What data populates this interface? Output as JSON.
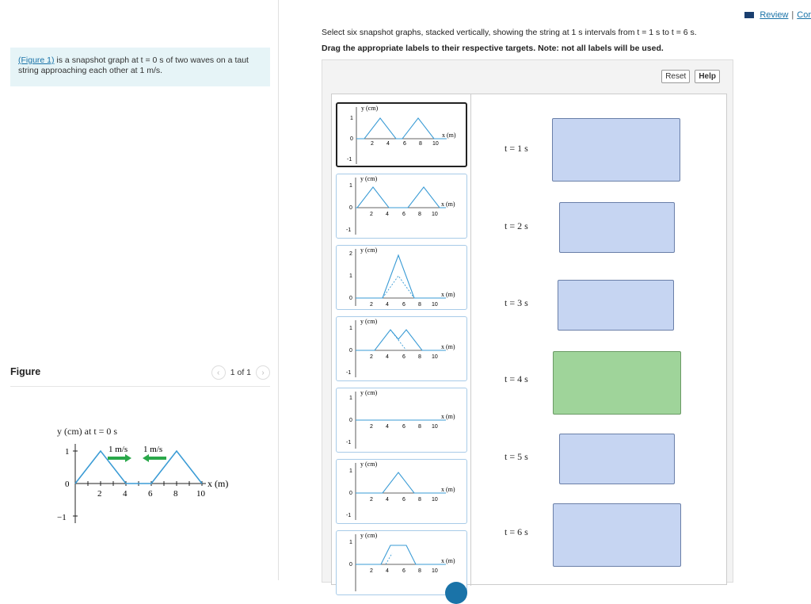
{
  "left": {
    "intro_link": "(Figure 1)",
    "intro_text": " is a snapshot graph at t = 0 s of two waves on a taut string approaching each other at 1 m/s.",
    "figure_title": "Figure",
    "pager_text": "1 of 1",
    "figure": {
      "ylabel": "y (cm) at t = 0 s",
      "xlabel": "x (m)",
      "speed_left": "1 m/s",
      "speed_right": "1 m/s",
      "yticks": [
        "1",
        "0",
        "−1"
      ],
      "xticks": [
        "2",
        "4",
        "6",
        "8",
        "10"
      ],
      "arrow_color": "#2aa84a",
      "wave_color": "#3a9bd5"
    }
  },
  "top": {
    "review": "Review",
    "sep": "|",
    "cont": "Cor"
  },
  "instructions": {
    "line1": "Select six snapshot graphs, stacked vertically, showing the string at 1 s intervals from t = 1 s to t = 6 s.",
    "line2": "Drag the appropriate labels to their respective targets. Note: not all labels will be used."
  },
  "buttons": {
    "reset": "Reset",
    "help": "Help"
  },
  "graph_text": {
    "y": "y (cm)",
    "x": "x (m)"
  },
  "targets": [
    {
      "label": "t = 1 s",
      "color": "#c6d5f2"
    },
    {
      "label": "t = 2 s",
      "color": "#c6d5f2"
    },
    {
      "label": "t = 3 s",
      "color": "#c6d5f2"
    },
    {
      "label": "t = 4 s",
      "color": "#9fd49a"
    },
    {
      "label": "t = 5 s",
      "color": "#c6d5f2"
    },
    {
      "label": "t = 6 s",
      "color": "#c6d5f2"
    }
  ]
}
